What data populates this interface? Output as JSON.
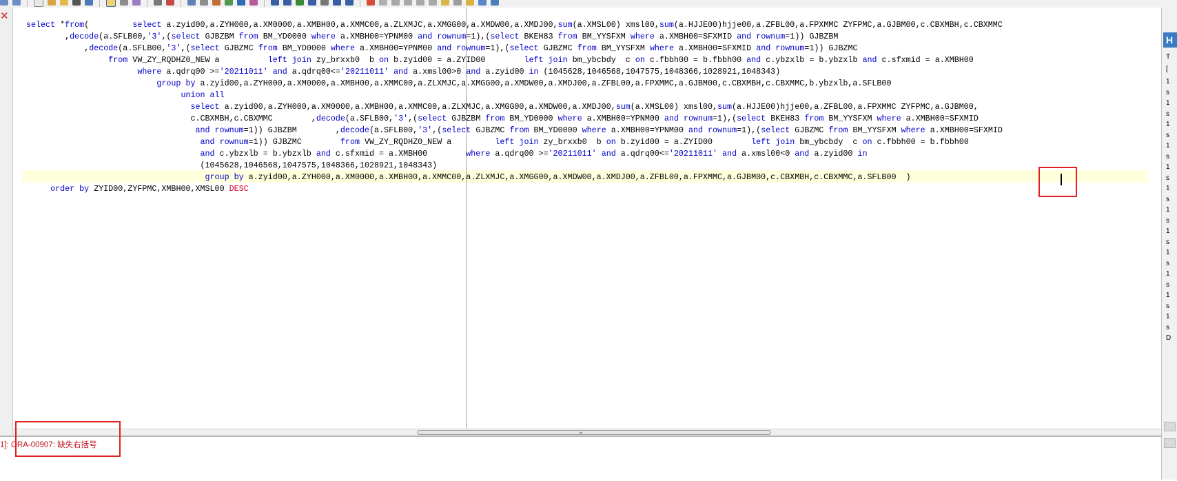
{
  "editor": {
    "sql_lines": [
      "select *from(         select a.zyid00,a.ZYH000,a.XM0000,a.XMBH00,a.XMMC00,a.ZLXMJC,a.XMGG00,a.XMDW00,a.XMDJ00,sum(a.XMSL00) xmsl00,sum(a.HJJE00)hjje00,a.ZFBL00,a.FPXMMC ZYFPMC,a.GJBM00,c.CBXMBH,c.CBXMMC",
      "        ,decode(a.SFLB00,'3',(select GJBZBM from BM_YD0000 where a.XMBH00=YPNM00 and rownum=1),(select BKEH83 from BM_YYSFXM where a.XMBH00=SFXMID and rownum=1)) GJBZBM",
      "            ,decode(a.SFLB00,'3',(select GJBZMC from BM_YD0000 where a.XMBH00=YPNM00 and rownum=1),(select GJBZMC from BM_YYSFXM where a.XMBH00=SFXMID and rownum=1)) GJBZMC",
      "                 from VW_ZY_RQDHZ0_NEW a          left join zy_brxxb0  b on b.zyid00 = a.ZYID00        left join bm_ybcbdy  c on c.fbbh00 = b.fbbh00 and c.ybzxlb = b.ybzxlb and c.sfxmid = a.XMBH00",
      "                       where a.qdrq00 >='20211011' and a.qdrq00<='20211011' and a.xmsl00>0 and a.zyid00 in (1045628,1046568,1047575,1048366,1028921,1048343)",
      "                           group by a.zyid00,a.ZYH000,a.XM0000,a.XMBH00,a.XMMC00,a.ZLXMJC,a.XMGG00,a.XMDW00,a.XMDJ00,a.ZFBL00,a.FPXMMC,a.GJBM00,c.CBXMBH,c.CBXMMC,b.ybzxlb,a.SFLB00",
      "                                union all",
      "                                  select a.zyid00,a.ZYH000,a.XM0000,a.XMBH00,a.XMMC00,a.ZLXMJC,a.XMGG00,a.XMDW00,a.XMDJ00,sum(a.XMSL00) xmsl00,sum(a.HJJE00)hjje00,a.ZFBL00,a.FPXMMC ZYFPMC,a.GJBM00,",
      "                                  c.CBXMBH,c.CBXMMC        ,decode(a.SFLB00,'3',(select GJBZBM from BM_YD0000 where a.XMBH00=YPNM00 and rownum=1),(select BKEH83 from BM_YYSFXM where a.XMBH00=SFXMID",
      "                                   and rownum=1)) GJBZBM        ,decode(a.SFLB00,'3',(select GJBZMC from BM_YD0000 where a.XMBH00=YPNM00 and rownum=1),(select GJBZMC from BM_YYSFXM where a.XMBH00=SFXMID",
      "                                    and rownum=1)) GJBZMC        from VW_ZY_RQDHZ0_NEW a         left join zy_brxxb0  b on b.zyid00 = a.ZYID00        left join bm_ybcbdy  c on c.fbbh00 = b.fbbh00",
      "                                    and c.ybzxlb = b.ybzxlb and c.sfxmid = a.XMBH00        where a.qdrq00 >='20211011' and a.qdrq00<='20211011' and a.xmsl00<0 and a.zyid00 in",
      "                                    (1045628,1046568,1047575,1048366,1028921,1048343)",
      "                                     group by a.zyid00,a.ZYH000,a.XM0000,a.XMBH00,a.XMMC00,a.ZLXMJC,a.XMGG00,a.XMDW00,a.XMDJ00,a.ZFBL00,a.FPXMMC,a.GJBM00,c.CBXMBH,c.CBXMMC,a.SFLB00  )",
      "     order by ZYID00,ZYFPMC,XMBH00,XMSL00 DESC"
    ]
  },
  "messages": {
    "error_text": "1]: ORA-00907: 缺失右括号"
  },
  "right_panel": {
    "header": "H",
    "rows": [
      "T",
      "[",
      "1",
      "s",
      "1",
      "s",
      "1",
      "s",
      "1",
      "s",
      "1",
      "s",
      "1",
      "s",
      "1",
      "s",
      "1",
      "s",
      "1",
      "s",
      "1",
      "s",
      "1",
      "s",
      "1",
      "s",
      "D"
    ]
  },
  "colors": {
    "keyword": "#0000c8",
    "string": "#0000c8",
    "error": "#c0121e",
    "highlight_box": "#e02020"
  }
}
